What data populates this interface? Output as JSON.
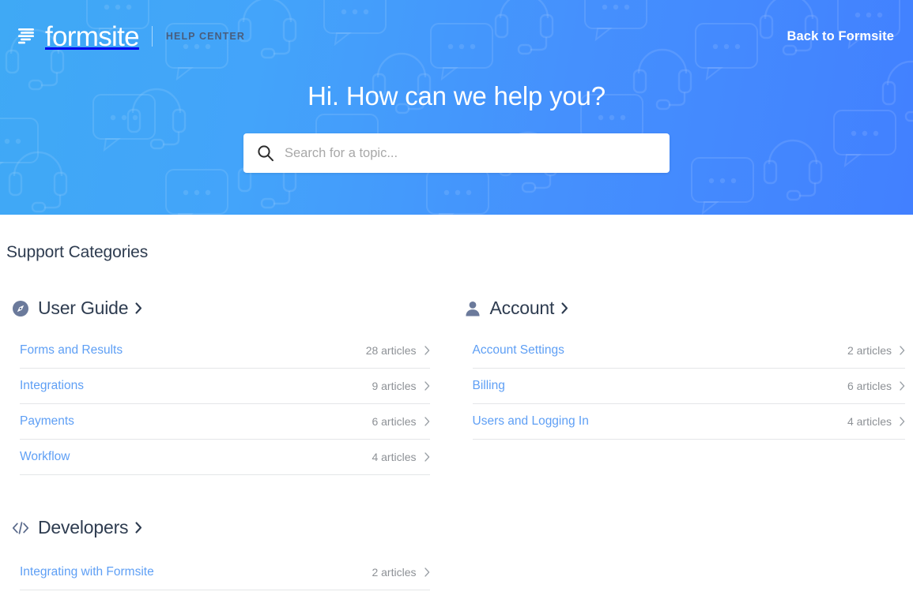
{
  "header": {
    "brand_name": "formsite",
    "brand_sub": "HELP CENTER",
    "brand_mark_icon": "formsite-logo-icon",
    "back_link": "Back to Formsite"
  },
  "hero": {
    "title": "Hi. How can we help you?",
    "search": {
      "placeholder": "Search for a topic...",
      "value": "",
      "icon": "search-icon"
    },
    "gradient_from": "#3fa9f5",
    "gradient_to": "#4280ff",
    "pattern_icons": [
      "chat-bubble-icon",
      "headset-icon"
    ]
  },
  "main": {
    "section_title": "Support Categories",
    "columns": [
      {
        "categories": [
          {
            "name": "User Guide",
            "icon": "compass-icon",
            "chevron": "chevron-right-icon",
            "rows": [
              {
                "label": "Forms and Results",
                "count": "28 articles",
                "chevron": "chevron-right-icon"
              },
              {
                "label": "Integrations",
                "count": "9 articles",
                "chevron": "chevron-right-icon"
              },
              {
                "label": "Payments",
                "count": "6 articles",
                "chevron": "chevron-right-icon"
              },
              {
                "label": "Workflow",
                "count": "4 articles",
                "chevron": "chevron-right-icon"
              }
            ]
          },
          {
            "name": "Developers",
            "icon": "code-icon",
            "chevron": "chevron-right-icon",
            "rows": [
              {
                "label": "Integrating with Formsite",
                "count": "2 articles",
                "chevron": "chevron-right-icon"
              }
            ]
          }
        ]
      },
      {
        "categories": [
          {
            "name": "Account",
            "icon": "user-icon",
            "chevron": "chevron-right-icon",
            "rows": [
              {
                "label": "Account Settings",
                "count": "2 articles",
                "chevron": "chevron-right-icon"
              },
              {
                "label": "Billing",
                "count": "6 articles",
                "chevron": "chevron-right-icon"
              },
              {
                "label": "Users and Logging In",
                "count": "4 articles",
                "chevron": "chevron-right-icon"
              }
            ]
          }
        ]
      }
    ]
  },
  "colors": {
    "link_blue": "#5e9ff5",
    "heading_dark": "#2e3c50",
    "icon_slate": "#6b7a9b",
    "count_gray": "#8d9196",
    "divider": "#e4e6e8"
  }
}
